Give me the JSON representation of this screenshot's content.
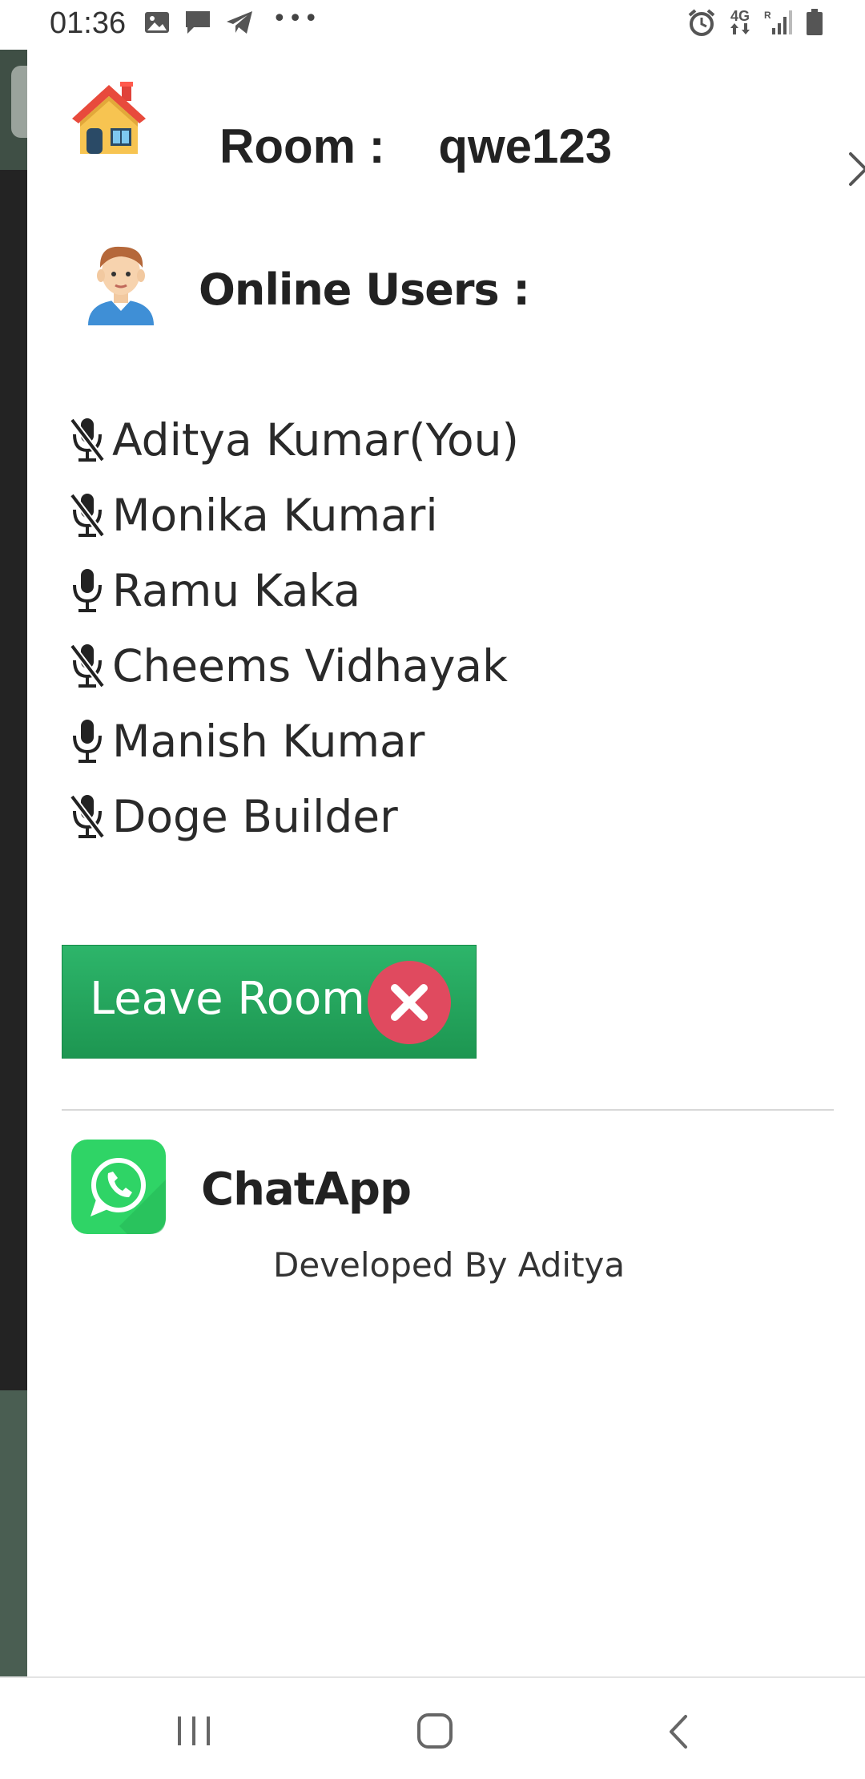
{
  "status_bar": {
    "time": "01:36",
    "left_icons": [
      "gallery-icon",
      "message-icon",
      "telegram-icon",
      "more-dots-icon"
    ],
    "right_icons": [
      "alarm-icon",
      "4g-data-icon",
      "signal-icon",
      "battery-icon"
    ],
    "network_label": "4G"
  },
  "room": {
    "label": "Room :",
    "name": "qwe123",
    "icon": "house-icon",
    "close_icon": "close-icon"
  },
  "online": {
    "title": "Online Users :",
    "icon": "user-avatar-icon"
  },
  "users": [
    {
      "name": "Aditya Kumar(You)",
      "mic": "muted"
    },
    {
      "name": "Monika Kumari",
      "mic": "muted"
    },
    {
      "name": "Ramu Kaka",
      "mic": "on"
    },
    {
      "name": "Cheems Vidhayak",
      "mic": "muted"
    },
    {
      "name": "Manish Kumar",
      "mic": "on"
    },
    {
      "name": "Doge Builder",
      "mic": "muted"
    }
  ],
  "leave_button": {
    "label": "Leave Room",
    "icon": "close-circle-icon",
    "color": "#27a862",
    "icon_color": "#e04a5f"
  },
  "footer": {
    "app_name": "ChatApp",
    "developer": "Developed By Aditya",
    "logo": "whatsapp-icon",
    "logo_color": "#2fd466"
  },
  "nav_bar": {
    "buttons": [
      "recent-apps-icon",
      "home-icon",
      "back-icon"
    ]
  }
}
